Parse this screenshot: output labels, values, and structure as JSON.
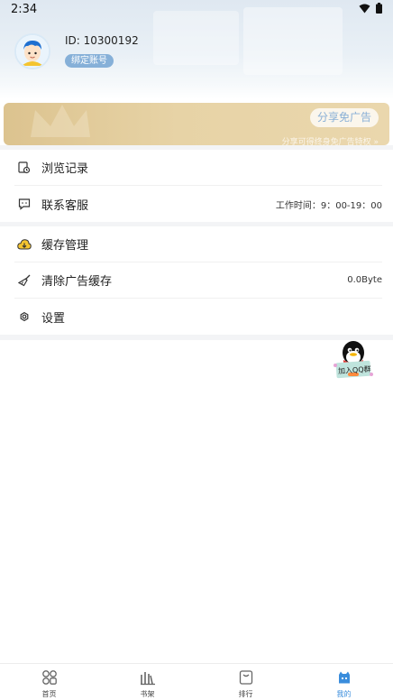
{
  "status_bar": {
    "time": "2:34"
  },
  "profile": {
    "id_text": "ID: 10300192",
    "bind_label": "绑定账号"
  },
  "share_banner": {
    "button_label": "分享免广告",
    "subtext": "分享可得终身免广告特权 »"
  },
  "menu_group_1": [
    {
      "label": "浏览记录",
      "value": ""
    },
    {
      "label": "联系客服",
      "value": "工作时间：9：00-19：00"
    }
  ],
  "menu_group_2": [
    {
      "label": "缓存管理",
      "value": ""
    },
    {
      "label": "清除广告缓存",
      "value": "0.0Byte"
    },
    {
      "label": "设置",
      "value": ""
    }
  ],
  "qq_float": {
    "label": "加入QQ群"
  },
  "tabbar": [
    {
      "label": "首页",
      "icon": "home-icon",
      "active": false
    },
    {
      "label": "书架",
      "icon": "bookshelf-icon",
      "active": false
    },
    {
      "label": "排行",
      "icon": "ranking-icon",
      "active": false
    },
    {
      "label": "我的",
      "icon": "mine-icon",
      "active": true
    }
  ],
  "colors": {
    "accent": "#3a8ddc",
    "badge": "#86b0d8",
    "banner": "#e2cc9c"
  }
}
